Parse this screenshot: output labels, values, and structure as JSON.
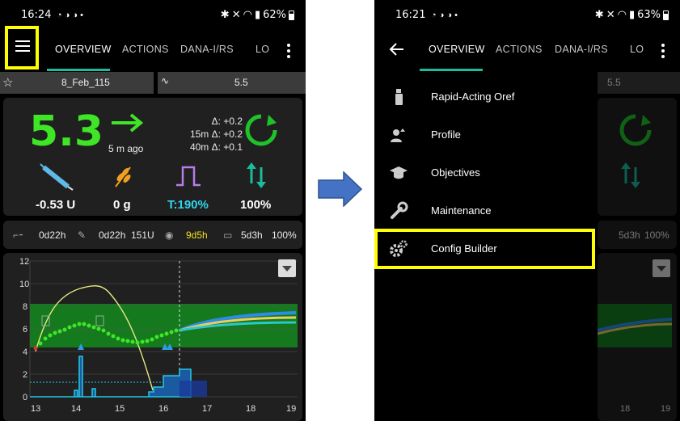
{
  "left": {
    "status": {
      "time": "16:24",
      "battery": "62%"
    },
    "tabs": [
      "OVERVIEW",
      "ACTIONS",
      "DANA-I/RS",
      "LO"
    ],
    "profile_chip": "8_Feb_115",
    "target_chip": "5.5",
    "bg": {
      "value": "5.3",
      "trend_icon": "arrow-right-icon",
      "ago": "5 m ago",
      "deltas": [
        "Δ: +0.2",
        "15m Δ: +0.2",
        "40m Δ: +0.1"
      ]
    },
    "stats": {
      "iob": "-0.53 U",
      "cob": "0 g",
      "temp_basal": "T:190%",
      "autosens": "100%"
    },
    "status_row": {
      "cannula": "0d22h",
      "insulin": "0d22h",
      "reservoir": "151U",
      "sensor": "9d5h",
      "battery": "5d3h",
      "battery_pct": "100%"
    },
    "chart_ticks_y": [
      "12",
      "10",
      "8",
      "6",
      "4",
      "2",
      "0"
    ],
    "chart_ticks_x": [
      "13",
      "14",
      "15",
      "16",
      "17",
      "18",
      "19"
    ]
  },
  "right": {
    "status": {
      "time": "16:21",
      "battery": "63%"
    },
    "tabs": [
      "OVERVIEW",
      "ACTIONS",
      "DANA-I/RS",
      "LO"
    ],
    "target_chip": "5.5",
    "drawer": [
      {
        "label": "Rapid-Acting Oref",
        "icon": "insulin-pen-icon"
      },
      {
        "label": "Profile",
        "icon": "profile-icon"
      },
      {
        "label": "Objectives",
        "icon": "graduation-cap-icon"
      },
      {
        "label": "Maintenance",
        "icon": "wrench-icon"
      },
      {
        "label": "Config Builder",
        "icon": "gears-icon"
      }
    ],
    "status_row": {
      "battery": "5d3h",
      "battery_pct": "100%"
    },
    "chart_ticks_x": [
      "18",
      "19"
    ]
  },
  "colors": {
    "bg_green": "#3ee626",
    "accent": "#1abc9c",
    "highlight": "#ffff00",
    "arrow_blue": "#4472c4",
    "cyan": "#23c7e8"
  }
}
